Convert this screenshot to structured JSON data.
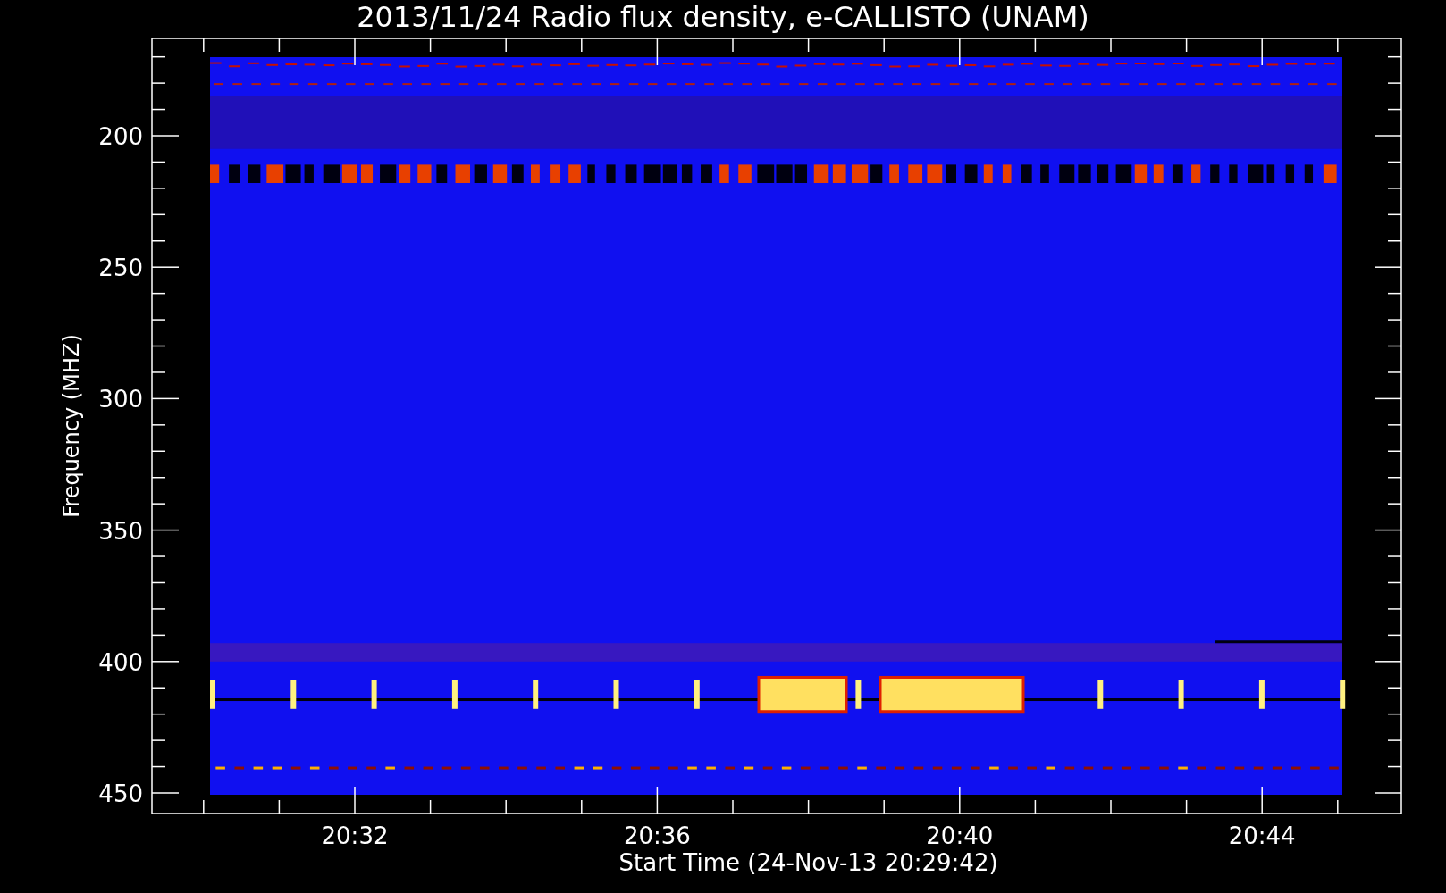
{
  "title": "2013/11/24  Radio flux density, e-CALLISTO (UNAM)",
  "y_axis": {
    "label": "Frequency (MHZ)",
    "ticks": [
      "200",
      "250",
      "300",
      "350",
      "400",
      "450"
    ]
  },
  "x_axis": {
    "label": "Start Time (24-Nov-13 20:29:42)",
    "ticks": [
      "20:32",
      "20:36",
      "20:40",
      "20:44"
    ]
  }
}
